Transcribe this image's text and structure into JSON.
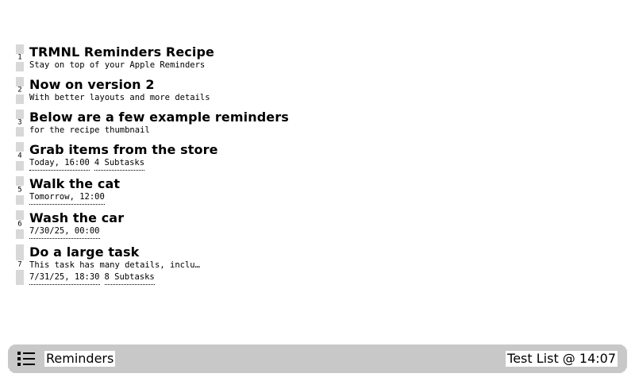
{
  "reminders": [
    {
      "index": "1",
      "title": "TRMNL Reminders Recipe",
      "note": "Stay on top of your Apple Reminders",
      "tags": []
    },
    {
      "index": "2",
      "title": "Now on version 2",
      "note": "With better layouts and more details",
      "tags": []
    },
    {
      "index": "3",
      "title": "Below are a few example reminders",
      "note": "for the recipe thumbnail",
      "tags": []
    },
    {
      "index": "4",
      "title": "Grab items from the store",
      "note": "",
      "tags": [
        "Today, 16:00",
        "4 Subtasks"
      ]
    },
    {
      "index": "5",
      "title": "Walk the cat",
      "note": "",
      "tags": [
        "Tomorrow, 12:00"
      ]
    },
    {
      "index": "6",
      "title": "Wash the car",
      "note": "",
      "tags": [
        "7/30/25, 00:00"
      ]
    },
    {
      "index": "7",
      "title": "Do a large task",
      "note": "This task has many details, inclu…",
      "tags": [
        "7/31/25, 18:30",
        "8 Subtasks"
      ]
    }
  ],
  "footer": {
    "icon": "list-icon",
    "app_name": "Reminders",
    "list_and_time": "Test List @ 14:07"
  }
}
